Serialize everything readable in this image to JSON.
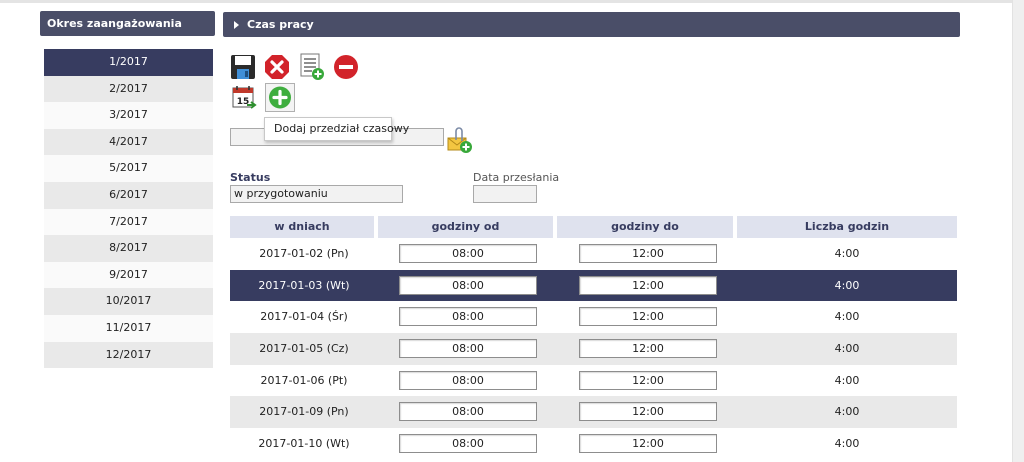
{
  "sidebar": {
    "title": "Okres zaangażowania",
    "selected": "1/2017",
    "items": [
      "1/2017",
      "2/2017",
      "3/2017",
      "4/2017",
      "5/2017",
      "6/2017",
      "7/2017",
      "8/2017",
      "9/2017",
      "10/2017",
      "11/2017",
      "12/2017"
    ]
  },
  "panel": {
    "title": "Czas pracy"
  },
  "toolbar": {
    "icons": [
      "save-icon",
      "delete-icon",
      "add-document-icon",
      "remove-icon",
      "calendar-icon",
      "add-icon"
    ],
    "tooltip": "Dodaj przedział czasowy"
  },
  "attachment": {
    "value": "",
    "icon": "attach-add-icon"
  },
  "status": {
    "label": "Status",
    "value": "w przygotowaniu"
  },
  "sent_date": {
    "label": "Data przesłania",
    "value": ""
  },
  "table": {
    "headers": [
      "w dniach",
      "godziny od",
      "godziny do",
      "Liczba godzin"
    ],
    "selected_row": 1,
    "rows": [
      {
        "date": "2017-01-02 (Pn)",
        "from": "08:00",
        "to": "12:00",
        "hours": "4:00"
      },
      {
        "date": "2017-01-03 (Wt)",
        "from": "08:00",
        "to": "12:00",
        "hours": "4:00"
      },
      {
        "date": "2017-01-04 (Śr)",
        "from": "08:00",
        "to": "12:00",
        "hours": "4:00"
      },
      {
        "date": "2017-01-05 (Cz)",
        "from": "08:00",
        "to": "12:00",
        "hours": "4:00"
      },
      {
        "date": "2017-01-06 (Pt)",
        "from": "08:00",
        "to": "12:00",
        "hours": "4:00"
      },
      {
        "date": "2017-01-09 (Pn)",
        "from": "08:00",
        "to": "12:00",
        "hours": "4:00"
      },
      {
        "date": "2017-01-10 (Wt)",
        "from": "08:00",
        "to": "12:00",
        "hours": "4:00"
      }
    ]
  },
  "colors": {
    "header": "#4a4e68",
    "selected": "#373c60",
    "table_header": "#dfe2ee"
  }
}
